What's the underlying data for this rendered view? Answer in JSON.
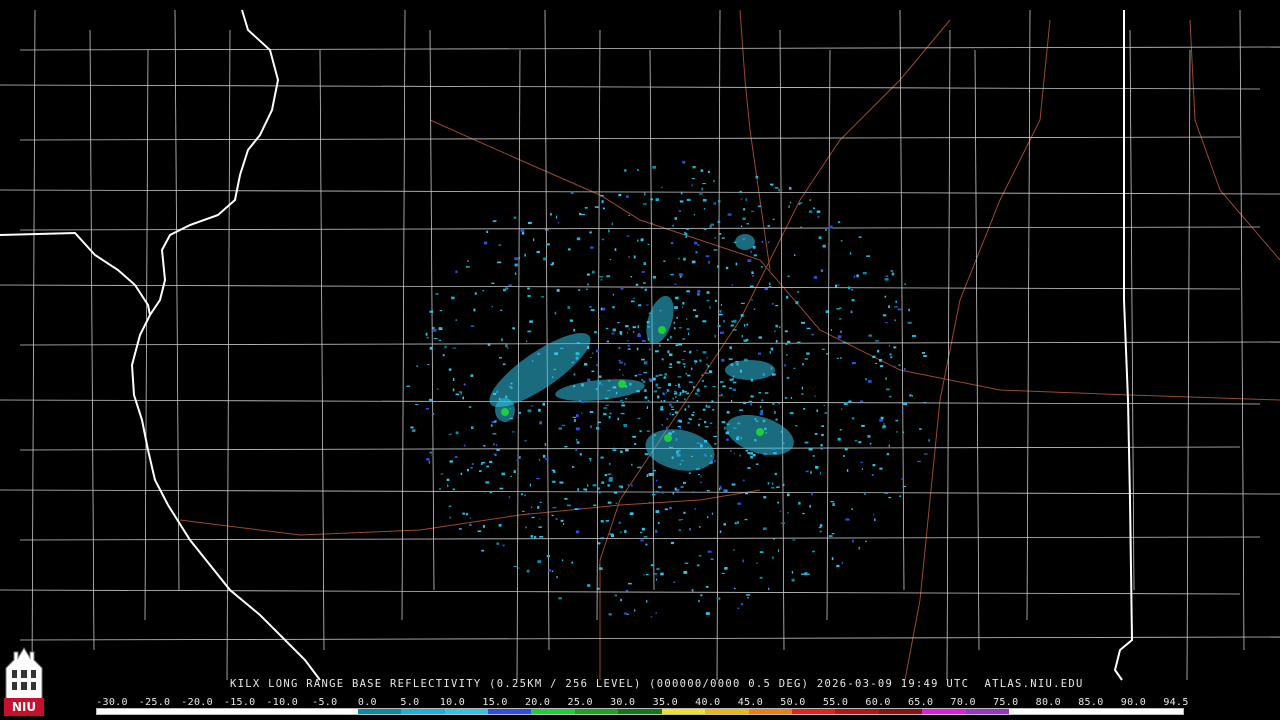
{
  "caption": {
    "text": "KILX LONG RANGE BASE REFLECTIVITY (0.25KM / 256 LEVEL) (000000/0000 0.5 DEG) 2026-03-09 19:49 UTC  ATLAS.NIU.EDU"
  },
  "logo": {
    "text": "NIU",
    "color": "#c8102e"
  },
  "colorbar": {
    "ticks": [
      "-30.0",
      "-25.0",
      "-20.0",
      "-15.0",
      "-10.0",
      "-5.0",
      "0.0",
      "5.0",
      "10.0",
      "15.0",
      "20.0",
      "25.0",
      "30.0",
      "35.0",
      "40.0",
      "45.0",
      "50.0",
      "55.0",
      "60.0",
      "65.0",
      "70.0",
      "75.0",
      "80.0",
      "85.0",
      "90.0",
      "94.5"
    ],
    "colors": [
      "#ffffff",
      "#ffffff",
      "#ffffff",
      "#ffffff",
      "#ffffff",
      "#ffffff",
      "#0c8ba5",
      "#18b3d6",
      "#31c3e8",
      "#2e4fe0",
      "#1fcf3a",
      "#19a51f",
      "#0f7a14",
      "#f0e21c",
      "#e8b80f",
      "#ec7f12",
      "#e4221a",
      "#b81414",
      "#8c1010",
      "#e01ce0",
      "#9b35c8",
      "#ffffff",
      "#ffffff",
      "#ffffff",
      "#ffffff"
    ]
  },
  "map": {
    "background": "#000000",
    "county_color": "#c9c9c9",
    "state_color": "#ffffff",
    "highway_color": "#9a4a2a",
    "radar_site": "KILX"
  }
}
